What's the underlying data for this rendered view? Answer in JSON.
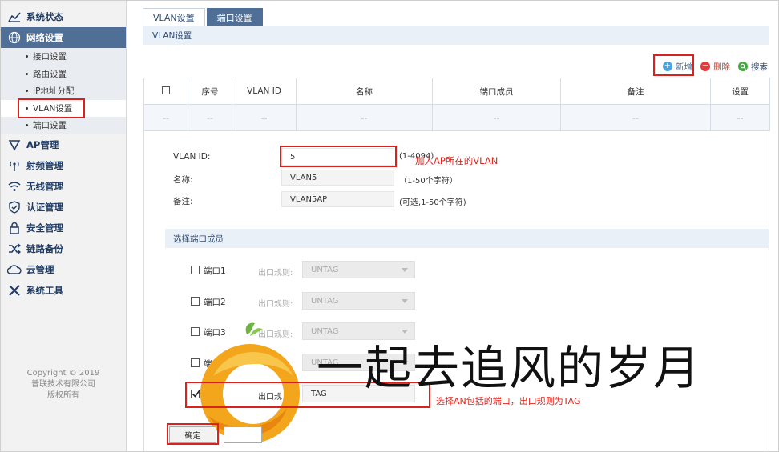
{
  "sidebar": {
    "items": [
      {
        "label": "系统状态",
        "icon": "chart-line-icon"
      },
      {
        "label": "网络设置",
        "icon": "globe-icon"
      },
      {
        "label": "AP管理",
        "icon": "shield-ap-icon"
      },
      {
        "label": "射频管理",
        "icon": "antenna-icon"
      },
      {
        "label": "无线管理",
        "icon": "wifi-icon"
      },
      {
        "label": "认证管理",
        "icon": "shield-check-icon"
      },
      {
        "label": "安全管理",
        "icon": "lock-icon"
      },
      {
        "label": "链路备份",
        "icon": "shuffle-icon"
      },
      {
        "label": "云管理",
        "icon": "cloud-icon"
      },
      {
        "label": "系统工具",
        "icon": "tools-icon"
      }
    ],
    "sub_items": [
      "接口设置",
      "路由设置",
      "IP地址分配",
      "VLAN设置",
      "端口设置"
    ],
    "copyright": [
      "Copyright © 2019",
      "普联技术有限公司",
      "版权所有"
    ]
  },
  "tabs": [
    "VLAN设置",
    "端口设置"
  ],
  "section_title": "VLAN设置",
  "toolbar": {
    "add": "新增",
    "delete": "删除",
    "search": "搜索"
  },
  "table": {
    "headers": [
      "序号",
      "VLAN ID",
      "名称",
      "端口成员",
      "备注",
      "设置"
    ],
    "empty_cell": "--"
  },
  "form": {
    "vlan_id_label": "VLAN ID:",
    "vlan_id_value": "5",
    "vlan_id_hint": "(1-4094)",
    "name_label": "名称:",
    "name_value": "VLAN5",
    "name_hint": "（1-50个字符）",
    "remark_label": "备注:",
    "remark_value": "VLAN5AP",
    "remark_hint": "(可选,1-50个字符)"
  },
  "members": {
    "title": "选择端口成员",
    "rule_label": "出口规则:",
    "ports": [
      {
        "label": "端口1",
        "rule": "UNTAG",
        "checked": false
      },
      {
        "label": "端口2",
        "rule": "UNTAG",
        "checked": false
      },
      {
        "label": "端口3",
        "rule": "UNTAG",
        "checked": false
      },
      {
        "label": "端",
        "rule": "UNTAG",
        "checked": false
      },
      {
        "label": "",
        "rule": "TAG",
        "checked": true
      }
    ],
    "last_rule_label": "出口规"
  },
  "annotations": {
    "vlan": "加入AP所在的VLAN",
    "tag": "选择AN包括的端口，出口规则为TAG"
  },
  "buttons": {
    "ok": "确定"
  },
  "watermark": "一起去追风的岁月",
  "colors": {
    "accent": "#4f6f97",
    "highlight": "#d9211d",
    "add": "#4aa3df",
    "delete": "#e23b3b",
    "search": "#3fa93a"
  }
}
